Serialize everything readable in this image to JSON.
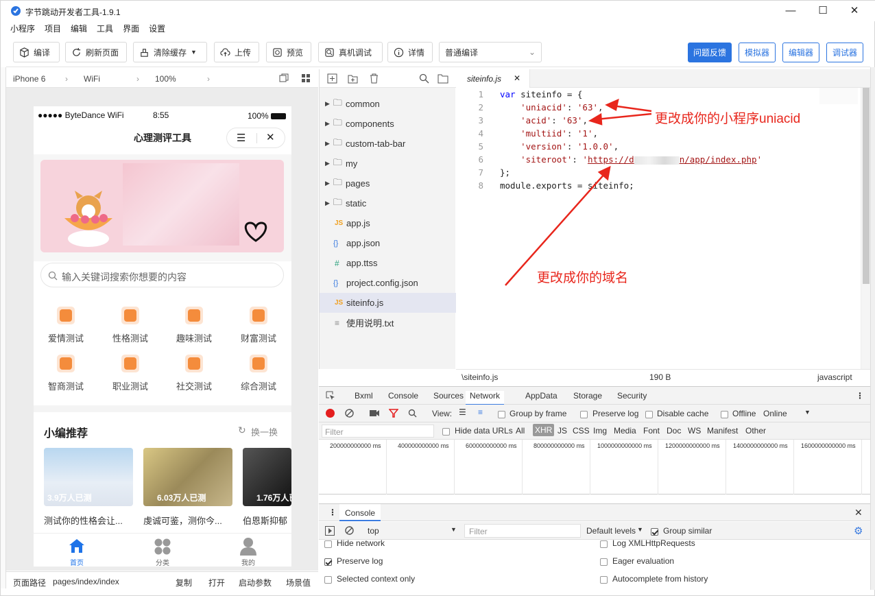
{
  "window": {
    "title": "字节跳动开发者工具-1.9.1"
  },
  "menu": [
    "小程序",
    "项目",
    "编辑",
    "工具",
    "界面",
    "设置"
  ],
  "toolbar": {
    "compile": "编译",
    "refresh": "刷新页面",
    "clear_cache": "清除缓存",
    "upload": "上传",
    "preview": "预览",
    "remote_debug": "真机调试",
    "details": "详情",
    "compile_mode": "普通编译",
    "feedback": "问题反馈",
    "simulator": "模拟器",
    "editor": "编辑器",
    "debugger": "调试器"
  },
  "simulator": {
    "device": "iPhone 6",
    "network": "WiFi",
    "zoom": "100%",
    "status": {
      "carrier": "●●●●● ByteDance WiFi",
      "time": "8:55",
      "battery": "100%"
    },
    "app_title": "心理测评工具",
    "search_placeholder": "输入关键词搜索你想要的内容",
    "categories": [
      "爱情测试",
      "性格测试",
      "趣味测试",
      "财富测试",
      "智商测试",
      "职业测试",
      "社交测试",
      "综合测试"
    ],
    "section_title": "小编推荐",
    "refresh_label": "换一换",
    "cards": [
      {
        "badge": "3.9万人已测",
        "title": "测试你的性格会让..."
      },
      {
        "badge": "6.03万人已测",
        "title": "虔诚可鉴，测你今..."
      },
      {
        "badge": "1.76万人已",
        "title": "伯恩斯抑郁"
      }
    ],
    "tabbar": [
      "首页",
      "分类",
      "我的"
    ]
  },
  "pathbar": {
    "label": "页面路径",
    "path": "pages/index/index",
    "copy": "复制",
    "open": "打开",
    "params": "启动参数",
    "scene": "场景值"
  },
  "filetree": {
    "folders": [
      "common",
      "components",
      "custom-tab-bar",
      "my",
      "pages",
      "static"
    ],
    "files": [
      {
        "name": "app.js",
        "icon": "JS",
        "color": "#f0a020"
      },
      {
        "name": "app.json",
        "icon": "{ }",
        "color": "#3a7be0"
      },
      {
        "name": "app.ttss",
        "icon": "#",
        "color": "#2aa27d"
      },
      {
        "name": "project.config.json",
        "icon": "{ }",
        "color": "#3a7be0"
      },
      {
        "name": "siteinfo.js",
        "icon": "JS",
        "color": "#f0a020"
      },
      {
        "name": "使用说明.txt",
        "icon": "≡",
        "color": "#888"
      }
    ]
  },
  "editor": {
    "tab": "siteinfo.js",
    "lines": [
      "1",
      "2",
      "3",
      "4",
      "5",
      "6",
      "7",
      "8"
    ],
    "code": {
      "l1a": "var",
      "l1b": " siteinfo = {",
      "l2a": "    ",
      "l2k": "'uniacid'",
      "l2m": ": ",
      "l2v": "'63'",
      "l2e": ",",
      "l3a": "    ",
      "l3k": "'acid'",
      "l3m": ": ",
      "l3v": "'63'",
      "l3e": ",",
      "l4a": "    ",
      "l4k": "'multiid'",
      "l4m": ": ",
      "l4v": "'1'",
      "l4e": ",",
      "l5a": "    ",
      "l5k": "'version'",
      "l5m": ": ",
      "l5v": "'1.0.0'",
      "l5e": ",",
      "l6a": "    ",
      "l6k": "'siteroot'",
      "l6m": ": ",
      "l6v1": "'",
      "l6v2": "https://d",
      "l6v3": "n/app/index.php",
      "l6v4": "'",
      "l7": "};",
      "l8": "module.exports = siteinfo;"
    },
    "annotations": {
      "uniacid": "更改成你的小程序uniacid",
      "domain": "更改成你的域名"
    },
    "status": {
      "path": "\\siteinfo.js",
      "size": "190 B",
      "lang": "javascript"
    }
  },
  "devtools": {
    "tabs": [
      "Bxml",
      "Console",
      "Sources",
      "Network",
      "AppData",
      "Storage",
      "Security"
    ],
    "active_tab": "Network",
    "net": {
      "view": "View:",
      "group_by_frame": "Group by frame",
      "preserve_log": "Preserve log",
      "disable_cache": "Disable cache",
      "offline": "Offline",
      "online": "Online"
    },
    "filter": {
      "placeholder": "Filter",
      "hide_data_urls": "Hide data URLs",
      "types": [
        "All",
        "XHR",
        "JS",
        "CSS",
        "Img",
        "Media",
        "Font",
        "Doc",
        "WS",
        "Manifest",
        "Other"
      ],
      "active_type": "XHR"
    },
    "timeline": [
      "200000000000 ms",
      "400000000000 ms",
      "600000000000 ms",
      "800000000000 ms",
      "1000000000000 ms",
      "1200000000000 ms",
      "1400000000000 ms",
      "1600000000000 ms"
    ],
    "console": {
      "tab": "Console",
      "context": "top",
      "filter": "Filter",
      "levels": "Default levels",
      "group_similar": "Group similar",
      "settings_left": [
        {
          "label": "Hide network",
          "checked": false
        },
        {
          "label": "Preserve log",
          "checked": true
        },
        {
          "label": "Selected context only",
          "checked": false
        }
      ],
      "settings_right": [
        {
          "label": "Log XMLHttpRequests",
          "checked": false
        },
        {
          "label": "Eager evaluation",
          "checked": false
        },
        {
          "label": "Autocomplete from history",
          "checked": false
        }
      ]
    }
  },
  "colors": {
    "accent": "#2b74e0",
    "annotation": "#e8261c",
    "orange": "#f48c3c"
  }
}
